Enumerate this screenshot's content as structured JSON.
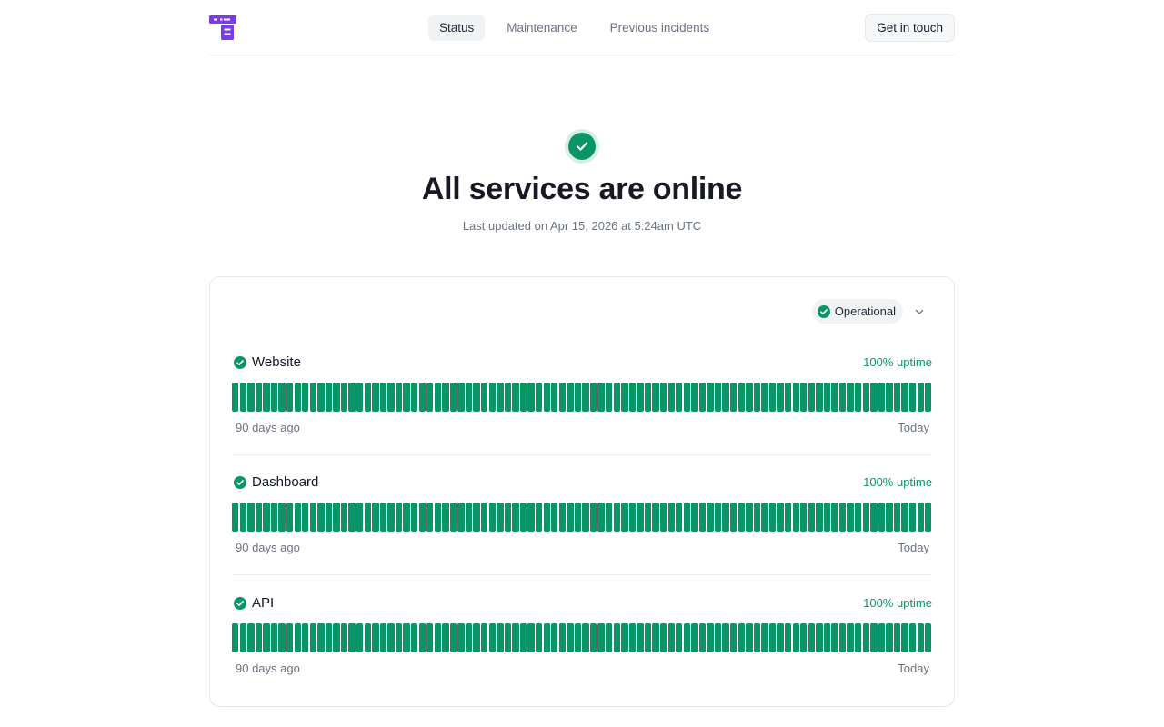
{
  "header": {
    "nav": [
      {
        "label": "Status",
        "active": true
      },
      {
        "label": "Maintenance",
        "active": false
      },
      {
        "label": "Previous incidents",
        "active": false
      }
    ],
    "contact_label": "Get in touch"
  },
  "hero": {
    "title": "All services are online",
    "subtitle": "Last updated on Apr 15, 2026 at 5:24am UTC"
  },
  "status_filter": {
    "label": "Operational"
  },
  "services": [
    {
      "name": "Website",
      "uptime": "100% uptime",
      "start_label": "90 days ago",
      "end_label": "Today",
      "days": 90
    },
    {
      "name": "Dashboard",
      "uptime": "100% uptime",
      "start_label": "90 days ago",
      "end_label": "Today",
      "days": 90
    },
    {
      "name": "API",
      "uptime": "100% uptime",
      "start_label": "90 days ago",
      "end_label": "Today",
      "days": 90
    }
  ],
  "colors": {
    "operational": "#0b9467",
    "brand": "#7c3aed"
  },
  "icons": {
    "logo": "brand-logo",
    "status": "check-circle-icon",
    "dropdown": "chevron-down-icon"
  }
}
